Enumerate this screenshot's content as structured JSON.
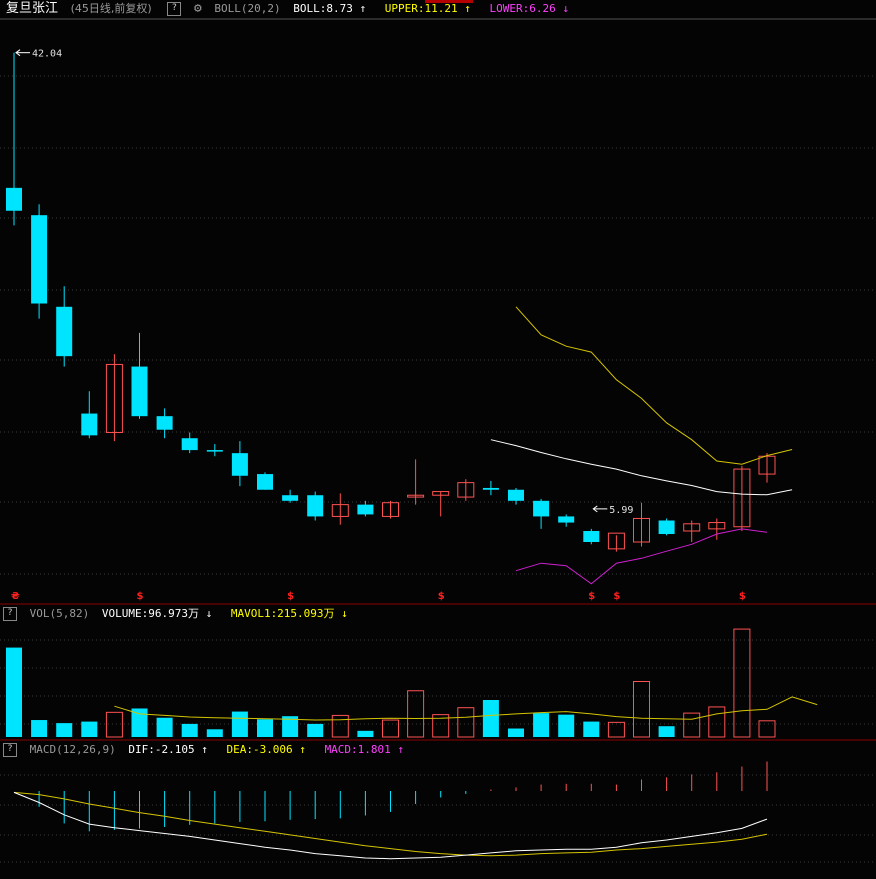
{
  "title": "复旦张江",
  "subtitle": "(45日线,前复权)",
  "help_glyph": "?",
  "gear_glyph": "⚙",
  "colors": {
    "bg": "#040404",
    "up": "#ff5252",
    "down": "#00e5ff",
    "white": "#ffffff",
    "yellow": "#ffff00",
    "magenta": "#ff40ff",
    "grid": "#3a3a3a",
    "label": "#e0e0e0"
  },
  "price_header": {
    "name": "BOLL(20,2)",
    "items": [
      {
        "label": "BOLL:8.73",
        "arrow": "↑",
        "color": "#ffffff"
      },
      {
        "label": "UPPER:11.21",
        "arrow": "↑",
        "color": "#ffff00"
      },
      {
        "label": "LOWER:6.26",
        "arrow": "↓",
        "color": "#ff40ff"
      }
    ]
  },
  "vol_header": {
    "name": "VOL(5,82)",
    "items": [
      {
        "label": "VOLUME:96.973万",
        "arrow": "↓",
        "color": "#ffffff"
      },
      {
        "label": "MAVOL1:215.093万",
        "arrow": "↓",
        "color": "#ffff00"
      }
    ]
  },
  "macd_header": {
    "name": "MACD(12,26,9)",
    "items": [
      {
        "label": "DIF:-2.105",
        "arrow": "↑",
        "color": "#ffffff"
      },
      {
        "label": "DEA:-3.006",
        "arrow": "↑",
        "color": "#ffff00"
      },
      {
        "label": "MACD:1.801",
        "arrow": "↑",
        "color": "#ff40ff"
      }
    ]
  },
  "chart_data": [
    {
      "type": "candlestick",
      "annotations": [
        {
          "text": "42.04",
          "x": 0,
          "value": 42.04
        },
        {
          "text": "5.99",
          "x": 23,
          "value": 5.99
        }
      ],
      "ohlc": [
        [
          23.6,
          42.04,
          20.1,
          21.4
        ],
        [
          21.0,
          22.0,
          13.5,
          14.4
        ],
        [
          14.2,
          15.5,
          11.0,
          11.5
        ],
        [
          9.0,
          9.9,
          8.1,
          8.2
        ],
        [
          8.3,
          11.6,
          8.0,
          11.1
        ],
        [
          11.0,
          12.7,
          8.8,
          8.9
        ],
        [
          8.9,
          9.2,
          8.1,
          8.4
        ],
        [
          8.1,
          8.3,
          7.6,
          7.7
        ],
        [
          7.7,
          7.9,
          7.5,
          7.65
        ],
        [
          7.6,
          8.0,
          6.6,
          6.9
        ],
        [
          6.95,
          7.0,
          6.5,
          6.5
        ],
        [
          6.35,
          6.5,
          6.15,
          6.2
        ],
        [
          6.35,
          6.45,
          5.7,
          5.8
        ],
        [
          5.8,
          6.4,
          5.6,
          6.1
        ],
        [
          6.1,
          6.2,
          5.8,
          5.85
        ],
        [
          5.8,
          6.2,
          5.75,
          6.15
        ],
        [
          6.3,
          7.4,
          6.1,
          6.35
        ],
        [
          6.35,
          6.45,
          5.8,
          6.45
        ],
        [
          6.3,
          6.8,
          6.2,
          6.7
        ],
        [
          6.55,
          6.75,
          6.35,
          6.5
        ],
        [
          6.5,
          6.55,
          6.1,
          6.2
        ],
        [
          6.2,
          6.25,
          5.5,
          5.8
        ],
        [
          5.8,
          5.85,
          5.55,
          5.65
        ],
        [
          5.45,
          5.5,
          5.15,
          5.2
        ],
        [
          5.05,
          5.35,
          4.99,
          5.4
        ],
        [
          5.2,
          6.15,
          5.1,
          5.75
        ],
        [
          5.7,
          5.75,
          5.35,
          5.38
        ],
        [
          5.45,
          5.7,
          5.2,
          5.62
        ],
        [
          5.5,
          5.75,
          5.25,
          5.65
        ],
        [
          5.55,
          7.2,
          5.45,
          7.1
        ],
        [
          6.95,
          7.6,
          6.7,
          7.5
        ]
      ],
      "boll_mid_start": 19,
      "boll_mid": [
        8.05,
        7.85,
        7.62,
        7.42,
        7.25,
        7.1,
        6.9,
        6.75,
        6.62,
        6.45,
        6.38,
        6.36,
        6.5
      ],
      "boll_upper_start": 20,
      "boll_upper": [
        14.2,
        12.6,
        12.0,
        11.7,
        10.4,
        9.6,
        8.65,
        8.05,
        7.35,
        7.25,
        7.52,
        7.72
      ],
      "boll_lower_start": 20,
      "boll_lower": [
        4.6,
        4.75,
        4.7,
        4.35,
        4.75,
        4.85,
        5.0,
        5.15,
        5.38,
        5.5,
        5.42
      ]
    },
    {
      "type": "bar",
      "name": "VOL",
      "volume": [
        580,
        110,
        90,
        100,
        160,
        185,
        125,
        85,
        50,
        165,
        115,
        135,
        85,
        140,
        40,
        110,
        300,
        145,
        190,
        240,
        55,
        155,
        145,
        100,
        95,
        360,
        70,
        155,
        195,
        700,
        105
      ],
      "mavol1_start": 4,
      "mavol1": [
        200,
        150,
        140,
        130,
        125,
        122,
        118,
        115,
        110,
        112,
        118,
        122,
        120,
        122,
        128,
        140,
        150,
        158,
        165,
        150,
        132,
        122,
        118,
        115,
        150,
        170,
        180,
        260,
        210
      ]
    },
    {
      "type": "line",
      "name": "MACD",
      "dif": [
        -0.2,
        -1.6,
        -3.3,
        -4.6,
        -5.1,
        -5.5,
        -5.9,
        -6.3,
        -6.8,
        -7.3,
        -7.8,
        -8.2,
        -8.7,
        -9.0,
        -9.3,
        -9.4,
        -9.3,
        -9.2,
        -8.9,
        -8.6,
        -8.3,
        -8.2,
        -8.1,
        -8.1,
        -7.8,
        -7.2,
        -6.8,
        -6.3,
        -5.8,
        -5.2,
        -3.9
      ],
      "dea": [
        -0.2,
        -0.5,
        -1.1,
        -1.8,
        -2.4,
        -3.0,
        -3.5,
        -4.1,
        -4.6,
        -5.1,
        -5.6,
        -6.1,
        -6.6,
        -7.1,
        -7.6,
        -8.0,
        -8.4,
        -8.7,
        -8.9,
        -9.0,
        -8.9,
        -8.7,
        -8.6,
        -8.5,
        -8.2,
        -8.0,
        -7.7,
        -7.4,
        -7.1,
        -6.7,
        -6.0
      ],
      "histogram": [
        0.0,
        -2.2,
        -4.5,
        -5.6,
        -5.4,
        -5.2,
        -5.0,
        -4.7,
        -4.5,
        -4.3,
        -4.2,
        -4.0,
        -3.9,
        -3.8,
        -3.4,
        -2.9,
        -1.8,
        -0.9,
        -0.4,
        0.2,
        0.5,
        0.9,
        1.0,
        1.0,
        0.9,
        1.6,
        1.9,
        2.3,
        2.6,
        3.4,
        4.1
      ]
    }
  ]
}
